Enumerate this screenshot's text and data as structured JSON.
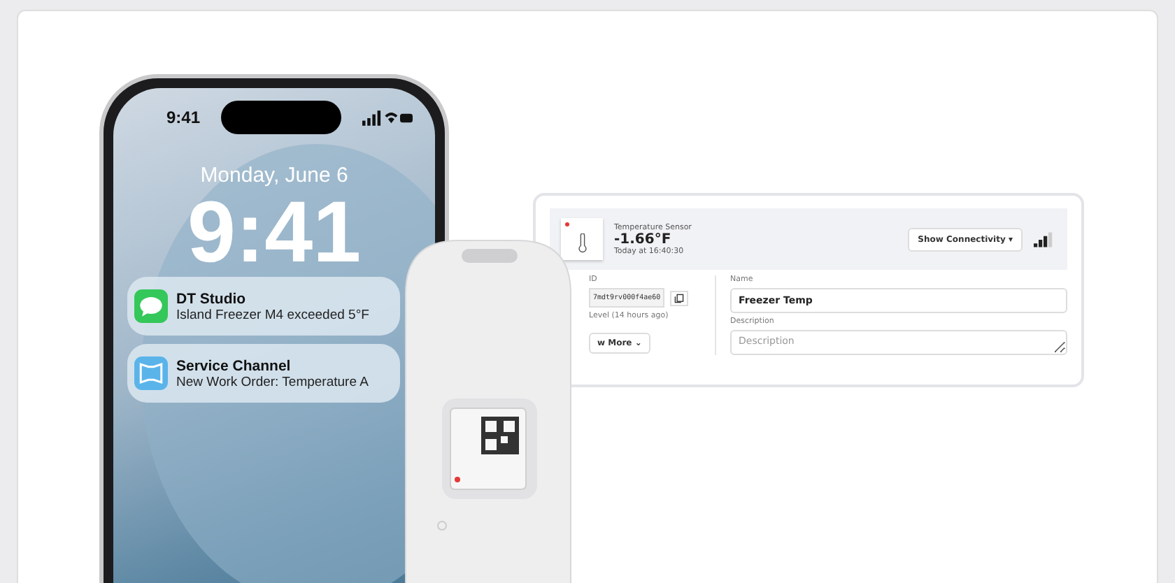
{
  "phone": {
    "status_time": "9:41",
    "date": "Monday, June 6",
    "clock": "9:41",
    "notifications": [
      {
        "kind": "messages",
        "app": "DT Studio",
        "text": "Island Freezer M4 exceeded 5°F"
      },
      {
        "kind": "service",
        "app": "Service Channel",
        "text": "New Work Order: Temperature A"
      }
    ]
  },
  "sensor_card": {
    "type": "Temperature Sensor",
    "reading": "-1.66°F",
    "time": "Today at 16:40:30",
    "alert": true,
    "connectivity_button": "Show Connectivity ▾",
    "id_label": "ID",
    "id_value": "7mdt9rv000f4ae60",
    "level_label": "Level (14 hours ago)",
    "more_button": "w More ⌄",
    "name_label": "Name",
    "name_value": "Freezer Temp",
    "description_label": "Description",
    "description_placeholder": "Description"
  }
}
